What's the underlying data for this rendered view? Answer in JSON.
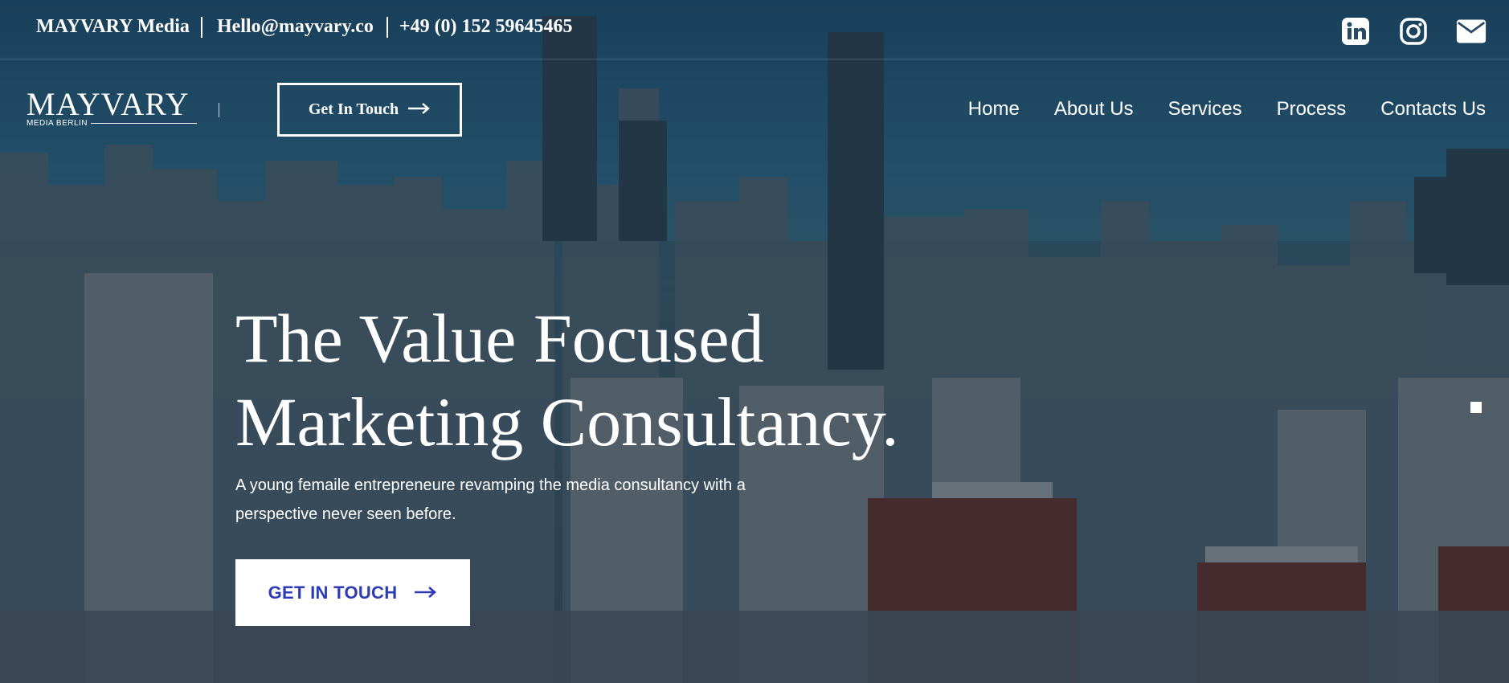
{
  "topbar": {
    "brand": "MAYVARY Media",
    "email": "Hello@mayvary.co",
    "phone": "+49 (0) 152 59645465",
    "socials": [
      {
        "name": "linkedin-icon"
      },
      {
        "name": "instagram-icon"
      },
      {
        "name": "mail-icon"
      }
    ]
  },
  "logo": {
    "word": "MAYVARY",
    "sub": "MEDIA BERLIN"
  },
  "header_button": {
    "label": "Get In Touch",
    "icon": "arrow-right-icon"
  },
  "nav": [
    "Home",
    "About Us",
    "Services",
    "Process",
    "Contacts Us"
  ],
  "hero": {
    "title_line1": "The Value Focused",
    "title_line2": "Marketing Consultancy.",
    "subtitle": "A young femaile entrepreneure revamping the media consultancy with a perspective never seen before.",
    "cta_label": "GET IN TOUCH",
    "cta_color": "#2d3bb5"
  }
}
